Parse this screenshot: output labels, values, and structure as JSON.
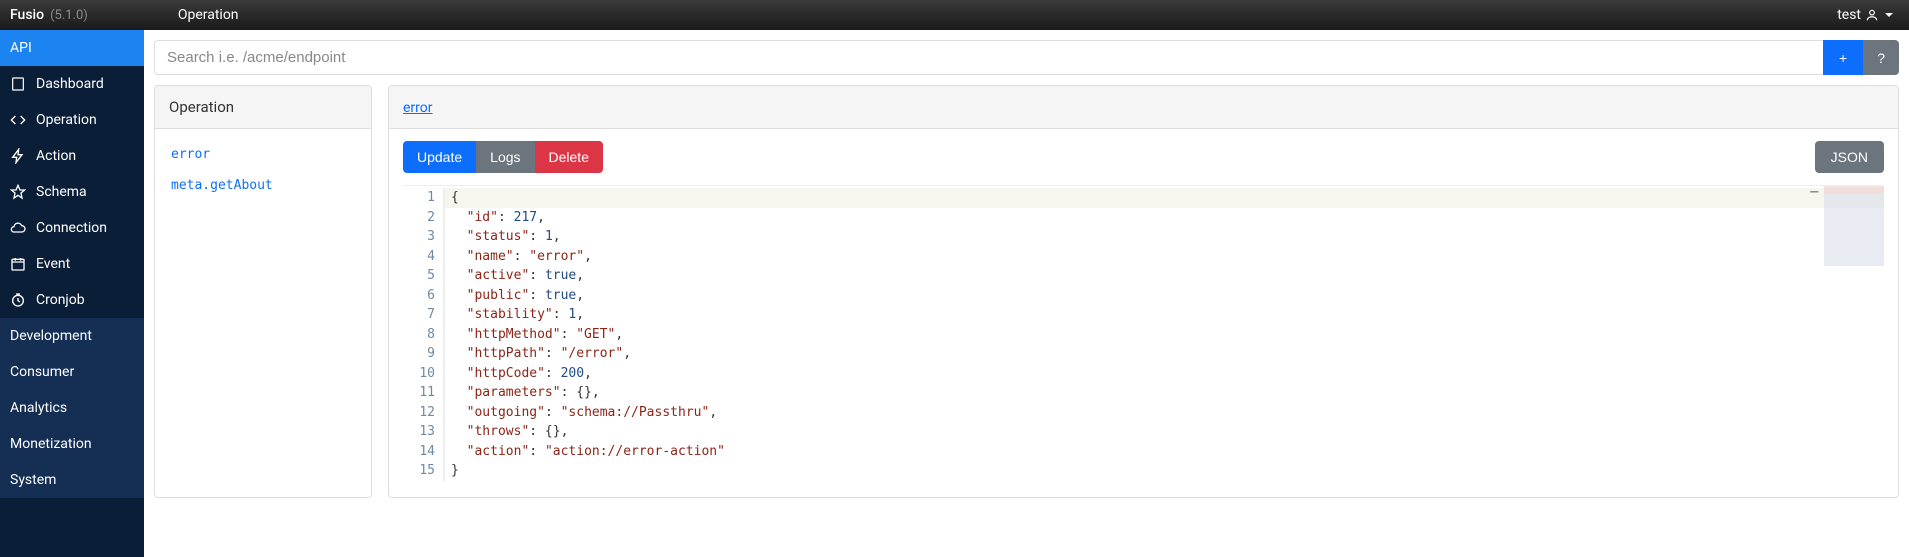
{
  "brand": {
    "name": "Fusio",
    "version": "(5.1.0)"
  },
  "header": {
    "title": "Operation"
  },
  "user": {
    "name": "test"
  },
  "search": {
    "placeholder": "Search i.e. /acme/endpoint",
    "add_label": "+",
    "help_label": "?"
  },
  "sidebar": {
    "items": [
      {
        "label": "API",
        "type": "cat",
        "icon": "",
        "active": true
      },
      {
        "label": "Dashboard",
        "type": "item",
        "icon": "dashboard"
      },
      {
        "label": "Operation",
        "type": "item",
        "icon": "code"
      },
      {
        "label": "Action",
        "type": "item",
        "icon": "bolt"
      },
      {
        "label": "Schema",
        "type": "item",
        "icon": "star"
      },
      {
        "label": "Connection",
        "type": "item",
        "icon": "cloud"
      },
      {
        "label": "Event",
        "type": "item",
        "icon": "calendar"
      },
      {
        "label": "Cronjob",
        "type": "item",
        "icon": "clock"
      },
      {
        "label": "Development",
        "type": "cat",
        "icon": ""
      },
      {
        "label": "Consumer",
        "type": "cat",
        "icon": ""
      },
      {
        "label": "Analytics",
        "type": "cat",
        "icon": ""
      },
      {
        "label": "Monetization",
        "type": "cat",
        "icon": ""
      },
      {
        "label": "System",
        "type": "cat",
        "icon": ""
      }
    ]
  },
  "list": {
    "title": "Operation",
    "items": [
      {
        "name": "error"
      },
      {
        "name": "meta.getAbout"
      }
    ]
  },
  "detail": {
    "title": "error",
    "buttons": {
      "update": "Update",
      "logs": "Logs",
      "delete": "Delete",
      "json": "JSON"
    },
    "editor": {
      "lines": [
        {
          "n": 1,
          "t": [
            [
              "p",
              "{"
            ]
          ],
          "hl": true
        },
        {
          "n": 2,
          "t": [
            [
              "p",
              "  "
            ],
            [
              "k",
              "\"id\""
            ],
            [
              "p",
              ": "
            ],
            [
              "n",
              "217"
            ],
            [
              "p",
              ","
            ]
          ]
        },
        {
          "n": 3,
          "t": [
            [
              "p",
              "  "
            ],
            [
              "k",
              "\"status\""
            ],
            [
              "p",
              ": "
            ],
            [
              "n",
              "1"
            ],
            [
              "p",
              ","
            ]
          ]
        },
        {
          "n": 4,
          "t": [
            [
              "p",
              "  "
            ],
            [
              "k",
              "\"name\""
            ],
            [
              "p",
              ": "
            ],
            [
              "k",
              "\"error\""
            ],
            [
              "p",
              ","
            ]
          ]
        },
        {
          "n": 5,
          "t": [
            [
              "p",
              "  "
            ],
            [
              "k",
              "\"active\""
            ],
            [
              "p",
              ": "
            ],
            [
              "b",
              "true"
            ],
            [
              "p",
              ","
            ]
          ]
        },
        {
          "n": 6,
          "t": [
            [
              "p",
              "  "
            ],
            [
              "k",
              "\"public\""
            ],
            [
              "p",
              ": "
            ],
            [
              "b",
              "true"
            ],
            [
              "p",
              ","
            ]
          ]
        },
        {
          "n": 7,
          "t": [
            [
              "p",
              "  "
            ],
            [
              "k",
              "\"stability\""
            ],
            [
              "p",
              ": "
            ],
            [
              "n",
              "1"
            ],
            [
              "p",
              ","
            ]
          ]
        },
        {
          "n": 8,
          "t": [
            [
              "p",
              "  "
            ],
            [
              "k",
              "\"httpMethod\""
            ],
            [
              "p",
              ": "
            ],
            [
              "k",
              "\"GET\""
            ],
            [
              "p",
              ","
            ]
          ]
        },
        {
          "n": 9,
          "t": [
            [
              "p",
              "  "
            ],
            [
              "k",
              "\"httpPath\""
            ],
            [
              "p",
              ": "
            ],
            [
              "k",
              "\"/error\""
            ],
            [
              "p",
              ","
            ]
          ]
        },
        {
          "n": 10,
          "t": [
            [
              "p",
              "  "
            ],
            [
              "k",
              "\"httpCode\""
            ],
            [
              "p",
              ": "
            ],
            [
              "n",
              "200"
            ],
            [
              "p",
              ","
            ]
          ]
        },
        {
          "n": 11,
          "t": [
            [
              "p",
              "  "
            ],
            [
              "k",
              "\"parameters\""
            ],
            [
              "p",
              ": {},"
            ]
          ]
        },
        {
          "n": 12,
          "t": [
            [
              "p",
              "  "
            ],
            [
              "k",
              "\"outgoing\""
            ],
            [
              "p",
              ": "
            ],
            [
              "k",
              "\"schema://Passthru\""
            ],
            [
              "p",
              ","
            ]
          ]
        },
        {
          "n": 13,
          "t": [
            [
              "p",
              "  "
            ],
            [
              "k",
              "\"throws\""
            ],
            [
              "p",
              ": {},"
            ]
          ]
        },
        {
          "n": 14,
          "t": [
            [
              "p",
              "  "
            ],
            [
              "k",
              "\"action\""
            ],
            [
              "p",
              ": "
            ],
            [
              "k",
              "\"action://error-action\""
            ]
          ]
        },
        {
          "n": 15,
          "t": [
            [
              "p",
              "}"
            ]
          ]
        }
      ]
    }
  }
}
